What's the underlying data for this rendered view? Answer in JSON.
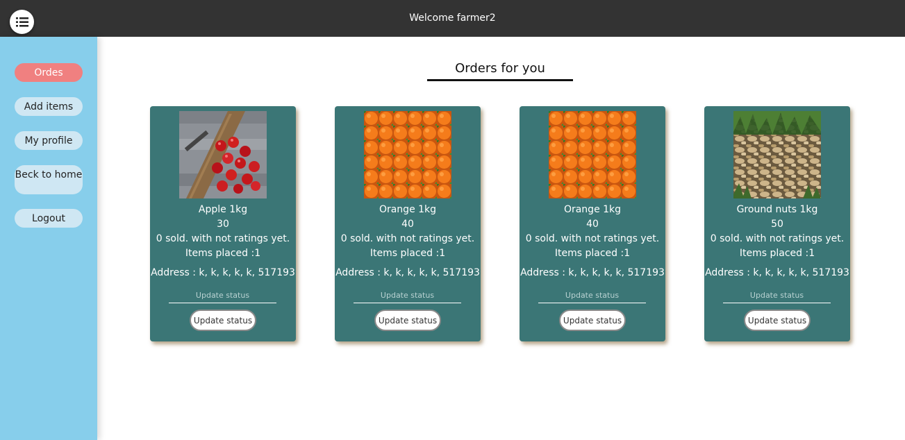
{
  "header": {
    "welcome": "Welcome farmer2",
    "menu_icon": "list-icon"
  },
  "sidebar": {
    "items": [
      {
        "label": "Ordes",
        "active": true
      },
      {
        "label": "Add items",
        "active": false
      },
      {
        "label": "My profile",
        "active": false
      },
      {
        "label": "Beck to home",
        "active": false
      },
      {
        "label": "Logout",
        "active": false
      }
    ]
  },
  "main": {
    "title": "Orders for you",
    "orders": [
      {
        "image": "apple-image",
        "name": "Apple 1kg",
        "price": "30",
        "sold": "0 sold. with not ratings yet.",
        "placed": "Items placed :1",
        "address": "Address : k, k, k, k, k, 517193",
        "status_placeholder": "Update status",
        "button": "Update status"
      },
      {
        "image": "orange-image",
        "name": "Orange 1kg",
        "price": "40",
        "sold": "0 sold. with not ratings yet.",
        "placed": "Items placed :1",
        "address": "Address : k, k, k, k, k, 517193",
        "status_placeholder": "Update status",
        "button": "Update status"
      },
      {
        "image": "orange-image",
        "name": "Orange 1kg",
        "price": "40",
        "sold": "0 sold. with not ratings yet.",
        "placed": "Items placed :1",
        "address": "Address : k, k, k, k, k, 517193",
        "status_placeholder": "Update status",
        "button": "Update status"
      },
      {
        "image": "ground-nuts-image",
        "name": "Ground nuts 1kg",
        "price": "50",
        "sold": "0 sold. with not ratings yet.",
        "placed": "Items placed :1",
        "address": "Address : k, k, k, k, k, 517193",
        "status_placeholder": "Update status",
        "button": "Update status"
      }
    ]
  },
  "colors": {
    "topbar": "#333333",
    "sidebar": "#87ceeb",
    "active_nav": "#f08080",
    "card": "#3b7676"
  }
}
